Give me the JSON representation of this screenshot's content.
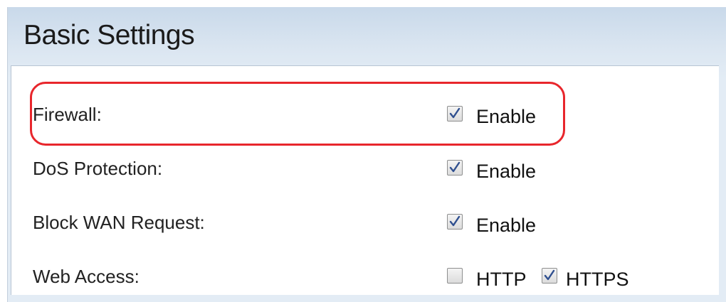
{
  "page": {
    "title": "Basic Settings"
  },
  "settings": {
    "firewall": {
      "label": "Firewall:",
      "option_label": "Enable",
      "checked": true
    },
    "dos_protection": {
      "label": "DoS Protection:",
      "option_label": "Enable",
      "checked": true
    },
    "block_wan_request": {
      "label": "Block WAN Request:",
      "option_label": "Enable",
      "checked": true
    },
    "web_access": {
      "label": "Web Access:",
      "http": {
        "label": "HTTP",
        "checked": false
      },
      "https": {
        "label": "HTTPS",
        "checked": true
      }
    }
  },
  "colors": {
    "highlight": "#e8262c",
    "checkmark": "#2f4f8f"
  }
}
